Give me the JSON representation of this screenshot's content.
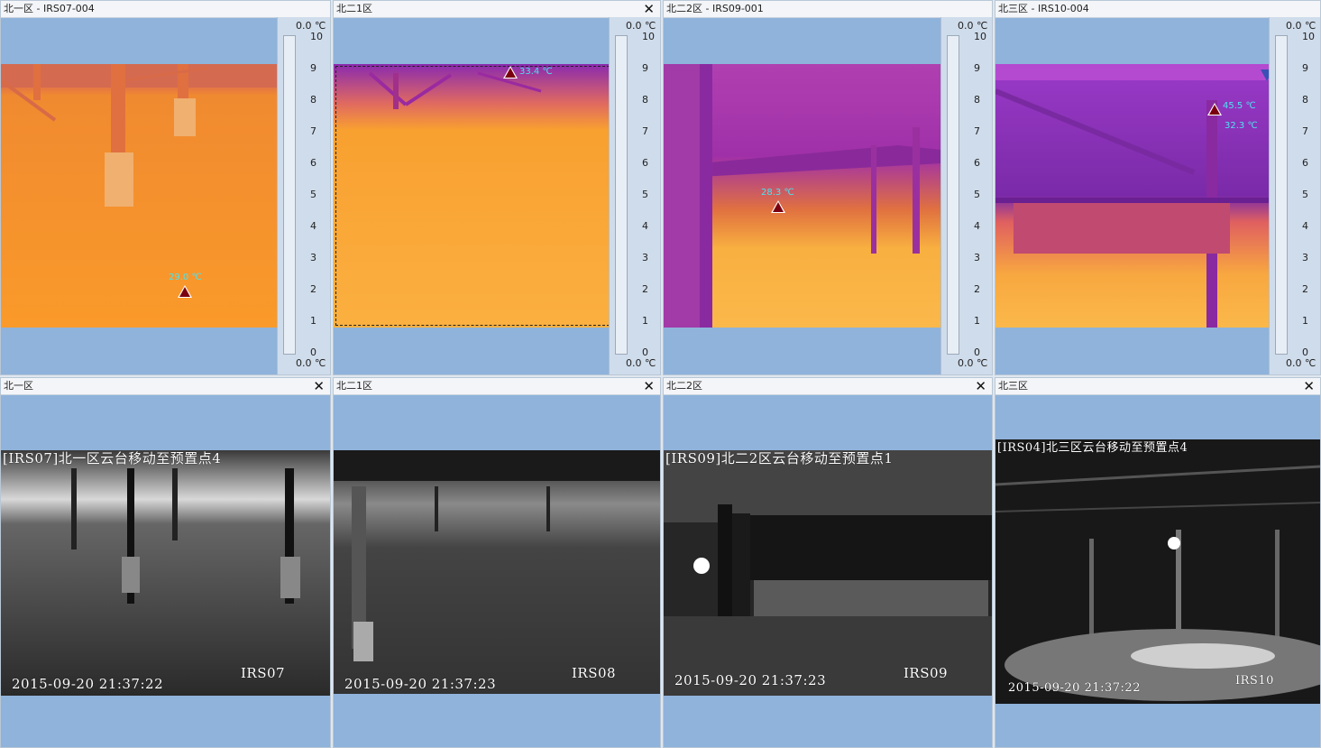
{
  "thermal_panes": [
    {
      "title": "北一区 - IRS07-004",
      "show_close": false,
      "markers": [
        {
          "label": "29.0 ℃"
        }
      ]
    },
    {
      "title": "北二1区",
      "show_close": true,
      "markers": [
        {
          "label": "33.4 ℃"
        }
      ]
    },
    {
      "title": "北二2区 - IRS09-001",
      "show_close": false,
      "markers": [
        {
          "label": "28.3 ℃"
        }
      ]
    },
    {
      "title": "北三区 - IRS10-004",
      "show_close": false,
      "markers": [
        {
          "label": "45.5 ℃"
        },
        {
          "label": "32.3 ℃"
        }
      ]
    }
  ],
  "scale": {
    "top_label": "0.0 ℃",
    "bottom_label": "0.0 ℃",
    "ticks": [
      "10",
      "9",
      "8",
      "7",
      "6",
      "5",
      "4",
      "3",
      "2",
      "1",
      "0"
    ]
  },
  "camera_panes": [
    {
      "title": "北一区",
      "osd_top": "[IRS07]北一区云台移动至预置点4",
      "timestamp": "2015-09-20 21:37:22",
      "cam_id": "IRS07"
    },
    {
      "title": "北二1区",
      "osd_top": "",
      "timestamp": "2015-09-20 21:37:23",
      "cam_id": "IRS08"
    },
    {
      "title": "北二2区",
      "osd_top": "[IRS09]北二2区云台移动至预置点1",
      "timestamp": "2015-09-20 21:37:23",
      "cam_id": "IRS09"
    },
    {
      "title": "北三区",
      "osd_top": "[IRS04]北三区云台移动至预置点4",
      "timestamp": "2015-09-20 21:37:22",
      "cam_id": "IRS10"
    }
  ],
  "close_symbol": "✕",
  "colors": {
    "pane_bg": "#8fb3db",
    "scale_bg": "#cfdceb",
    "marker_fill": "#7a0010",
    "temp_text": "#4de3f0"
  }
}
